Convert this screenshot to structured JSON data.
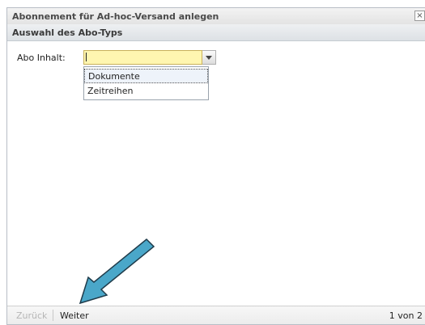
{
  "dialog": {
    "title": "Abonnement für Ad-hoc-Versand anlegen",
    "close_symbol": "×",
    "section_title": "Auswahl des Abo-Typs"
  },
  "form": {
    "label": "Abo Inhalt:",
    "combo_value": "",
    "combo_button_icon": "chevron-down-icon",
    "options": [
      "Dokumente",
      "Zeitreihen"
    ]
  },
  "footer": {
    "back_label": "Zurück",
    "next_label": "Weiter",
    "pager_text": "1 von 2"
  },
  "colors": {
    "input_highlight": "#fff6b0",
    "arrow_fill": "#4aa7c9",
    "arrow_stroke": "#1f3b4a"
  }
}
